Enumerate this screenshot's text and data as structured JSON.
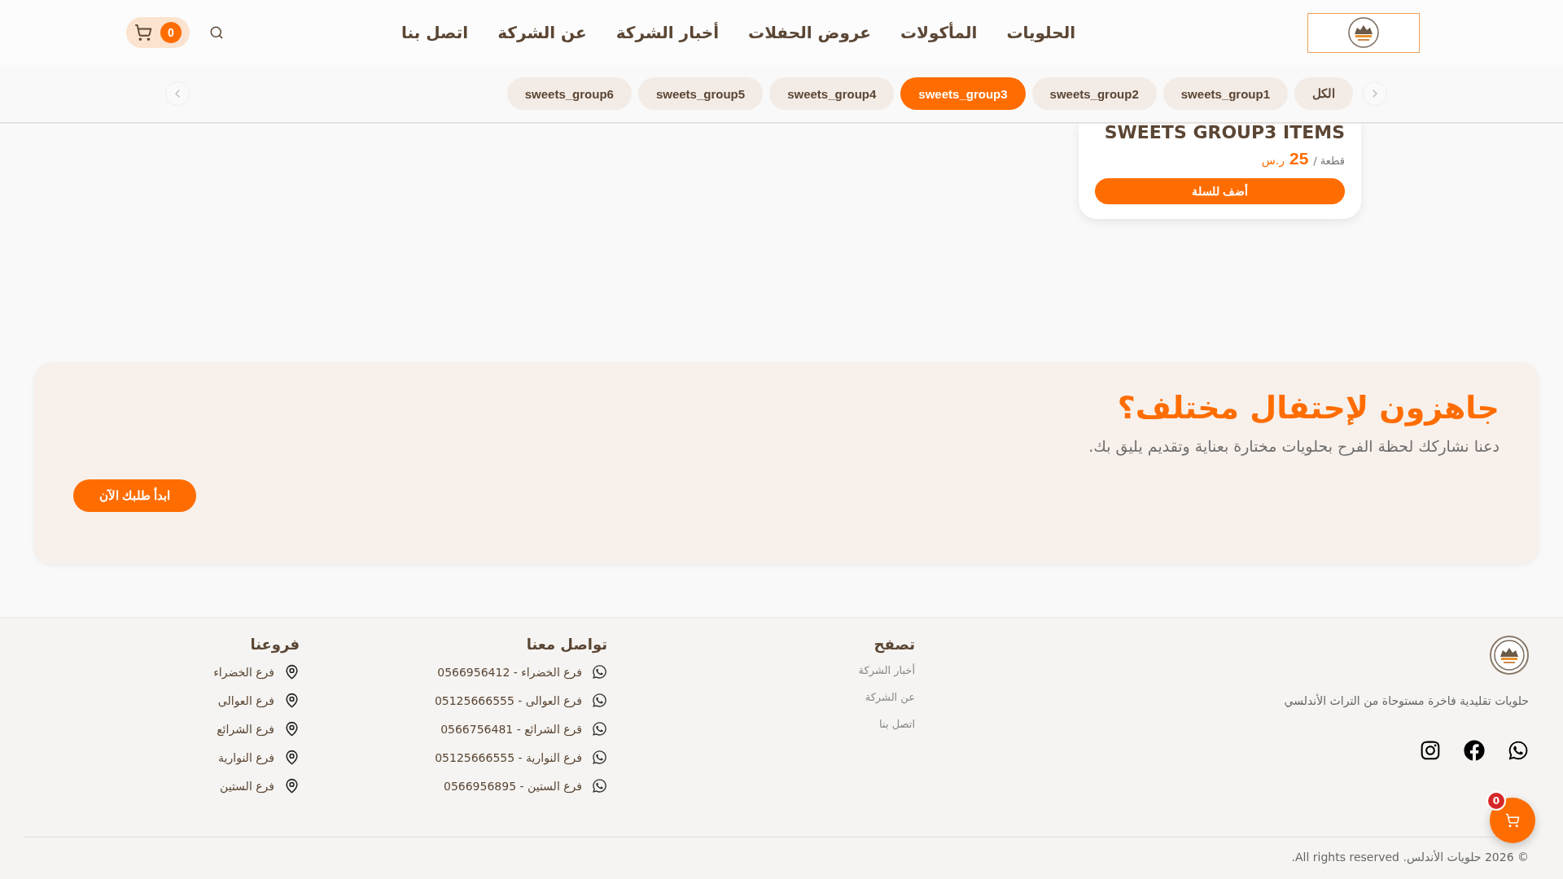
{
  "header": {
    "nav": [
      {
        "label": "الحلويات"
      },
      {
        "label": "المأكولات"
      },
      {
        "label": "عروض الحفلات"
      },
      {
        "label": "أخبار الشركة"
      },
      {
        "label": "عن الشركة"
      },
      {
        "label": "اتصل بنا"
      }
    ],
    "cart_count": "0"
  },
  "categories": [
    {
      "label": "الكل",
      "selected": false
    },
    {
      "label": "sweets_group1",
      "selected": false
    },
    {
      "label": "sweets_group2",
      "selected": false
    },
    {
      "label": "sweets_group3",
      "selected": true
    },
    {
      "label": "sweets_group4",
      "selected": false
    },
    {
      "label": "sweets_group5",
      "selected": false
    },
    {
      "label": "sweets_group6",
      "selected": false
    }
  ],
  "product": {
    "title": "SWEETS GROUP3 ITEMS",
    "unit": "قطعة /",
    "price": "25",
    "currency": "ر.س",
    "button": "أضف للسلة"
  },
  "banner": {
    "title": "جاهزون لإحتفال مختلف؟",
    "text": "دعنا نشاركك لحظة الفرح بحلويات مختارة بعناية وتقديم يليق بك.",
    "button": "ابدأ طلبك الآن"
  },
  "footer": {
    "tagline": "حلويات تقليدية فاخرة مستوحاة من التراث الأندلسي",
    "browse": {
      "title": "تصفح",
      "links": [
        "أخبار الشركة",
        "عن الشركة",
        "اتصل بنا"
      ]
    },
    "contact": {
      "title": "تواصل معنا",
      "items": [
        "فرع الخضراء - 0566956412",
        "فرع العوالى - 05125666555",
        "قرع الشرائع - 0566756481",
        "فرع النوارية - 05125666555",
        "فرع الستين - 0566956895"
      ]
    },
    "branches": {
      "title": "فروعنا",
      "items": [
        "فرع الخضراء",
        "فرع العوالى",
        "فرع الشرائع",
        "فرع النوارية",
        "فرع الستين"
      ]
    },
    "copyright": "© 2026 حلويات الأندلس. All rights reserved."
  },
  "floating_cart": {
    "count": "0"
  }
}
